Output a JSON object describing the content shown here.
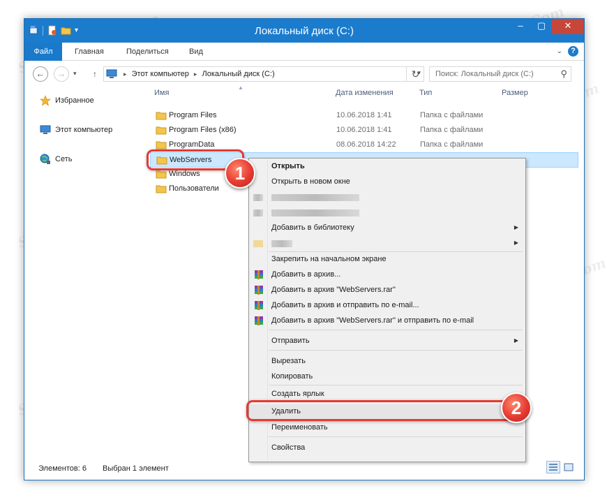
{
  "window": {
    "title": "Локальный диск (C:)"
  },
  "ribbon": {
    "tabs": [
      "Файл",
      "Главная",
      "Поделиться",
      "Вид"
    ]
  },
  "address": {
    "crumbs": [
      "Этот компьютер",
      "Локальный диск (C:)"
    ],
    "search_placeholder": "Поиск: Локальный диск (C:)"
  },
  "nav": {
    "favorites": "Избранное",
    "this_pc": "Этот компьютер",
    "network": "Сеть"
  },
  "columns": {
    "name": "Имя",
    "date": "Дата изменения",
    "type": "Тип",
    "size": "Размер"
  },
  "files": [
    {
      "name": "Program Files",
      "date": "10.06.2018 1:41",
      "type": "Папка с файлами"
    },
    {
      "name": "Program Files (x86)",
      "date": "10.06.2018 1:41",
      "type": "Папка с файлами"
    },
    {
      "name": "ProgramData",
      "date": "08.06.2018 14:22",
      "type": "Папка с файлами"
    },
    {
      "name": "WebServers",
      "date": "",
      "type": ""
    },
    {
      "name": "Windows",
      "date": "",
      "type": ""
    },
    {
      "name": "Пользователи",
      "date": "",
      "type": ""
    }
  ],
  "context_menu": {
    "open": "Открыть",
    "open_new_window": "Открыть в новом окне",
    "add_to_library": "Добавить в библиотеку",
    "pin_start": "Закрепить на начальном экране",
    "add_archive": "Добавить в архив...",
    "add_archive_named": "Добавить в архив \"WebServers.rar\"",
    "add_archive_email": "Добавить в архив и отправить по e-mail...",
    "add_archive_named_email": "Добавить в архив \"WebServers.rar\" и отправить по e-mail",
    "send_to": "Отправить",
    "cut": "Вырезать",
    "copy": "Копировать",
    "create_shortcut": "Создать ярлык",
    "delete": "Удалить",
    "rename": "Переименовать",
    "properties": "Свойства"
  },
  "status": {
    "items": "Элементов: 6",
    "selected": "Выбран 1 элемент"
  },
  "callouts": {
    "one": "1",
    "two": "2"
  },
  "watermark": "Sovinpoprpair.Com",
  "colors": {
    "title_bar": "#1b7ccd",
    "selection": "#cce8ff",
    "callout": "#e53a32",
    "close": "#c7463a"
  },
  "icons": {
    "qat": [
      "properties-icon",
      "new-folder-icon",
      "folder-icon"
    ],
    "nav": [
      "star-icon",
      "computer-icon",
      "network-icon"
    ],
    "rows": "folder-icon",
    "archive": "winrar-icon"
  }
}
